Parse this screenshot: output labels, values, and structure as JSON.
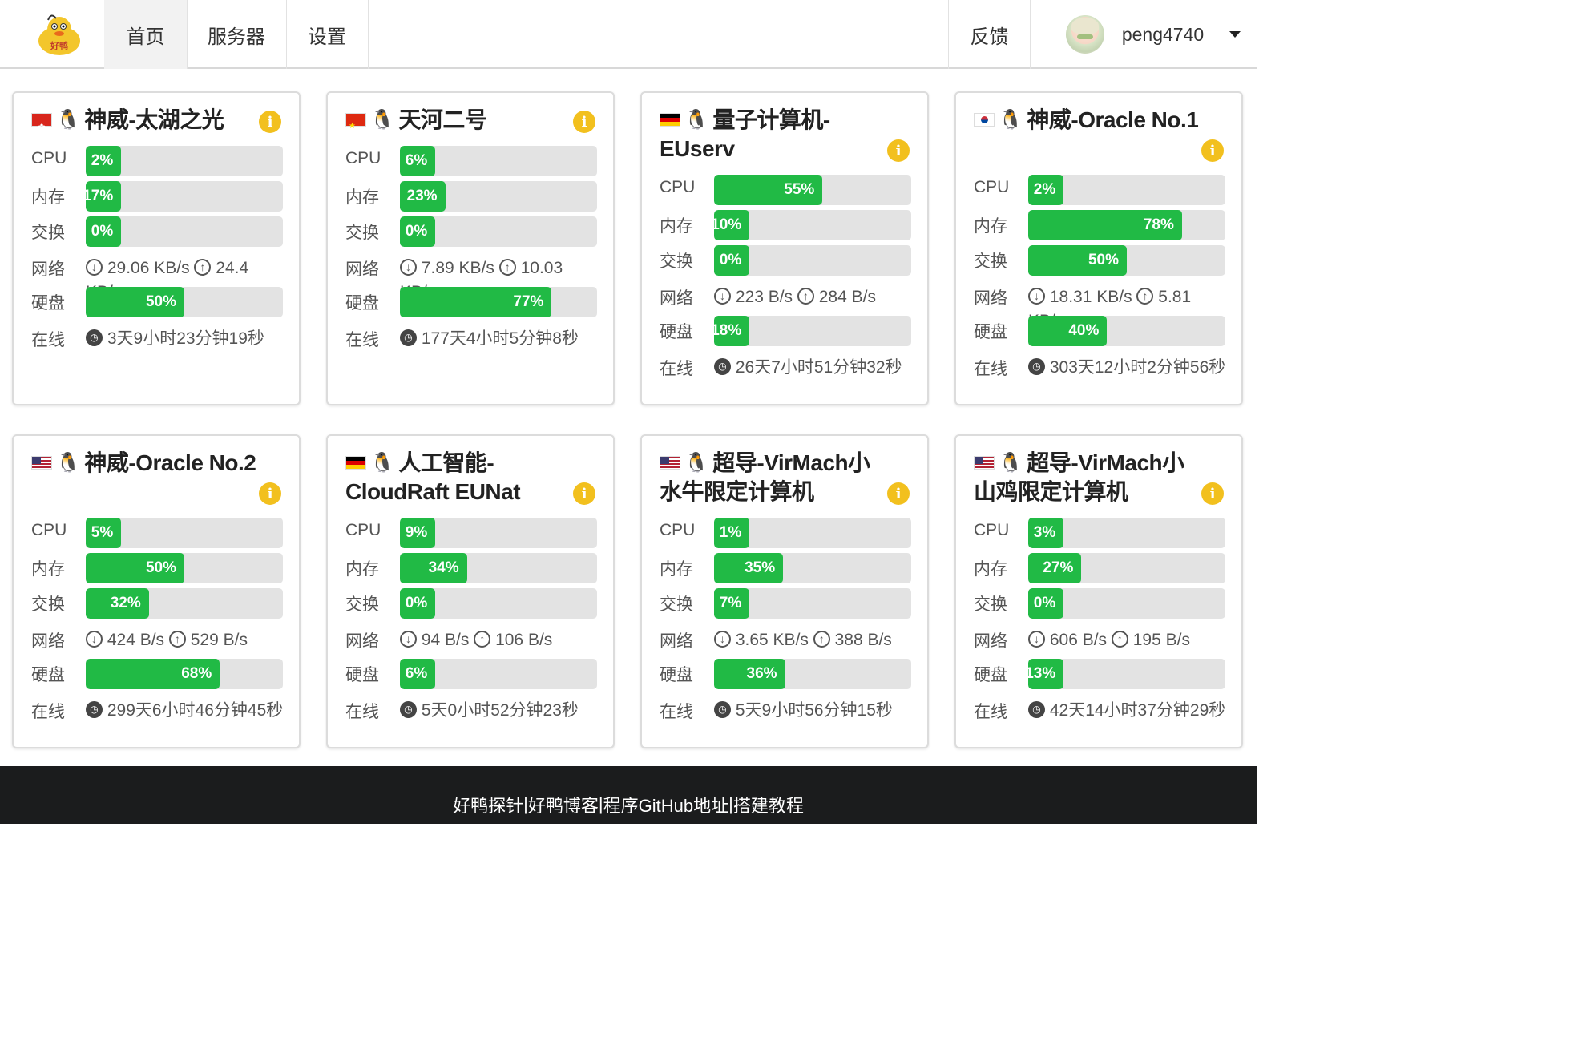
{
  "nav": {
    "logo_text": "好鸭",
    "tabs": [
      {
        "label": "首页",
        "active": true
      },
      {
        "label": "服务器",
        "active": false
      },
      {
        "label": "设置",
        "active": false
      }
    ],
    "feedback": "反馈",
    "username": "peng4740"
  },
  "labels": {
    "cpu": "CPU",
    "mem": "内存",
    "swap": "交换",
    "net": "网络",
    "disk": "硬盘",
    "uptime": "在线",
    "down_icon": "↓",
    "up_icon": "↑",
    "clock_icon": "◷"
  },
  "servers": [
    {
      "name": "神威-太湖之光",
      "flag": "hk",
      "os": "linux",
      "cpu": 2,
      "mem": 17,
      "swap": 0,
      "net_down": "29.06 KB/s",
      "net_up": "24.4 KB/s",
      "disk": 50,
      "uptime": "3天9小时23分钟19秒",
      "cpu_text": "2%",
      "mem_text": "17%",
      "swap_text": "0%",
      "disk_text": "50%"
    },
    {
      "name": "天河二号",
      "flag": "cn",
      "os": "linux",
      "cpu": 6,
      "mem": 23,
      "swap": 0,
      "net_down": "7.89 KB/s",
      "net_up": "10.03 KB/s",
      "disk": 77,
      "uptime": "177天4小时5分钟8秒",
      "cpu_text": "6%",
      "mem_text": "23%",
      "swap_text": "0%",
      "disk_text": "77%"
    },
    {
      "name": "量子计算机-EUserv",
      "flag": "de",
      "os": "linux",
      "cpu": 55,
      "mem": 10,
      "swap": 0,
      "net_down": "223 B/s",
      "net_up": "284 B/s",
      "disk": 18,
      "uptime": "26天7小时51分钟32秒",
      "cpu_text": "55%",
      "mem_text": "10%",
      "swap_text": "0%",
      "disk_text": "18%"
    },
    {
      "name": "神威-Oracle No.1",
      "flag": "kr",
      "os": "linux",
      "cpu": 2,
      "mem": 78,
      "swap": 50,
      "net_down": "18.31 KB/s",
      "net_up": "5.81 KB/s",
      "disk": 40,
      "uptime": "303天12小时2分钟56秒",
      "cpu_text": "2%",
      "mem_text": "78%",
      "swap_text": "50%",
      "disk_text": "40%"
    },
    {
      "name": "神威-Oracle No.2",
      "flag": "us",
      "os": "linux",
      "cpu": 5,
      "mem": 50,
      "swap": 32,
      "net_down": "424 B/s",
      "net_up": "529 B/s",
      "disk": 68,
      "uptime": "299天6小时46分钟45秒",
      "cpu_text": "5%",
      "mem_text": "50%",
      "swap_text": "32%",
      "disk_text": "68%"
    },
    {
      "name": "人工智能-CloudRaft EUNat",
      "flag": "de",
      "os": "linux",
      "cpu": 9,
      "mem": 34,
      "swap": 0,
      "net_down": "94 B/s",
      "net_up": "106 B/s",
      "disk": 6,
      "uptime": "5天0小时52分钟23秒",
      "cpu_text": "9%",
      "mem_text": "34%",
      "swap_text": "0%",
      "disk_text": "6%"
    },
    {
      "name": "超导-VirMach小水牛限定计算机",
      "flag": "us",
      "os": "linux",
      "cpu": 1,
      "mem": 35,
      "swap": 7,
      "net_down": "3.65 KB/s",
      "net_up": "388 B/s",
      "disk": 36,
      "uptime": "5天9小时56分钟15秒",
      "cpu_text": "1%",
      "mem_text": "35%",
      "swap_text": "7%",
      "disk_text": "36%"
    },
    {
      "name": "超导-VirMach小山鸡限定计算机",
      "flag": "us",
      "os": "linux",
      "cpu": 3,
      "mem": 27,
      "swap": 0,
      "net_down": "606 B/s",
      "net_up": "195 B/s",
      "disk": 13,
      "uptime": "42天14小时37分钟29秒",
      "cpu_text": "3%",
      "mem_text": "27%",
      "swap_text": "0%",
      "disk_text": "13%"
    }
  ],
  "footer": {
    "links": [
      "好鸭探针",
      "好鸭博客",
      "程序GitHub地址",
      "搭建教程"
    ],
    "separator": " | "
  },
  "colors": {
    "bar_fill": "#21ba45",
    "bar_bg": "#e3e3e3",
    "info": "#f2c01e",
    "footer_bg": "#1b1c1d"
  }
}
